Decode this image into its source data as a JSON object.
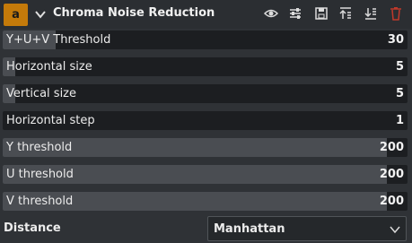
{
  "header": {
    "badge": "a",
    "title": "Chroma Noise Reduction",
    "icons": [
      "eye-icon",
      "sliders-icon",
      "save-icon",
      "move-up-icon",
      "move-down-icon",
      "delete-icon"
    ],
    "delete_color": "#c0392b",
    "badge_color": "#c47a0a"
  },
  "sliders": [
    {
      "label": "Y+U+V Threshold",
      "value": "30",
      "fill": 0.13
    },
    {
      "label": "Horizontal size",
      "value": "5",
      "fill": 0.03
    },
    {
      "label": "Vertical size",
      "value": "5",
      "fill": 0.03
    },
    {
      "label": "Horizontal step",
      "value": "1",
      "fill": 0.0
    },
    {
      "label": "Y threshold",
      "value": "200",
      "fill": 0.95
    },
    {
      "label": "U threshold",
      "value": "200",
      "fill": 0.95
    },
    {
      "label": "V threshold",
      "value": "200",
      "fill": 0.95
    }
  ],
  "distance": {
    "label": "Distance",
    "value": "Manhattan"
  }
}
